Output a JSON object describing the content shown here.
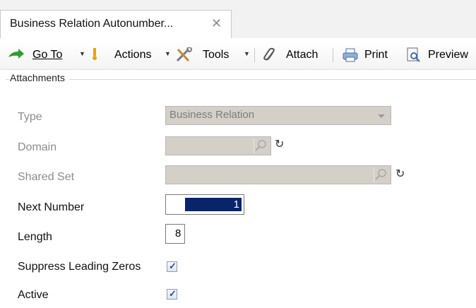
{
  "tab": {
    "title": "Business Relation Autonumber...",
    "close": "✕"
  },
  "toolbar": {
    "goto_label": "Go To",
    "actions_label": "Actions",
    "tools_label": "Tools",
    "attach_label": "Attach",
    "print_label": "Print",
    "preview_label": "Preview"
  },
  "group": {
    "label": "Attachments"
  },
  "form": {
    "type_label": "Type",
    "type_value": "Business Relation",
    "domain_label": "Domain",
    "domain_value": "",
    "shared_set_label": "Shared Set",
    "shared_set_value": "",
    "next_number_label": "Next Number",
    "next_number_value": "1",
    "length_label": "Length",
    "length_value": "8",
    "suppress_label": "Suppress Leading Zeros",
    "suppress_checked": true,
    "active_label": "Active",
    "active_checked": true,
    "check_glyph": "✓",
    "refresh_glyph": "↻"
  },
  "colors": {
    "selection": "#0a246a",
    "disabled_field": "#d4d0c8"
  }
}
